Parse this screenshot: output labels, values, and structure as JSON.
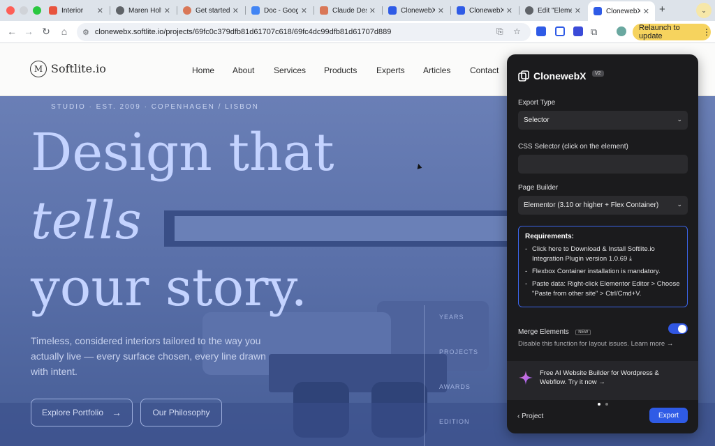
{
  "browser": {
    "tabs": [
      {
        "title": "Interior",
        "color": "#e8543e"
      },
      {
        "title": "Maren Holt",
        "color": "#5f6368"
      },
      {
        "title": "Get started",
        "color": "#d97757"
      },
      {
        "title": "Doc - Goog",
        "color": "#4285f4"
      },
      {
        "title": "Claude Des",
        "color": "#d97757"
      },
      {
        "title": "ClonewebX",
        "color": "#2f5be6"
      },
      {
        "title": "ClonewebX",
        "color": "#2f5be6"
      },
      {
        "title": "Edit \"Eleme",
        "color": "#5f6368"
      },
      {
        "title": "ClonewebX",
        "color": "#2f5be6"
      }
    ],
    "new_tab": "+",
    "url": "clonewebx.softlite.io/projects/69fc0c379dfb81d61707c618/69fc4dc99dfb81d61707d889",
    "relaunch_label": "Relaunch to update"
  },
  "site": {
    "logo_mark": "M",
    "logo_text": "Softlite.io",
    "nav": [
      "Home",
      "About",
      "Services",
      "Products",
      "Experts",
      "Articles",
      "Contact"
    ],
    "hero": {
      "eyebrow": "STUDIO · EST. 2009 · COPENHAGEN / LISBON",
      "line1": "Design that",
      "line2": "tells",
      "line3": "your story.",
      "subtitle": "Timeless, considered interiors tailored to the way you actually live — every surface chosen, every line drawn with intent.",
      "primary_button": "Explore Portfolio",
      "secondary_button": "Our Philosophy",
      "side_labels": [
        "YEARS",
        "PROJECTS",
        "AWARDS",
        "EDITION"
      ]
    }
  },
  "panel": {
    "title": "ClonewebX",
    "version": "V2",
    "export_type_label": "Export Type",
    "export_type_value": "Selector",
    "css_selector_label": "CSS Selector (click on the element)",
    "css_selector_value": "",
    "page_builder_label": "Page Builder",
    "page_builder_value": "Elementor (3.10 or higher + Flex Container)",
    "requirements": {
      "title": "Requirements:",
      "items": [
        "Click here to Download & Install Softlite.io Integration Plugin version 1.0.69",
        "Flexbox Container installation is mandatory.",
        "Paste data: Right-click Elementor Editor > Choose \"Paste from other site\" > Ctrl/Cmd+V."
      ]
    },
    "merge_label": "Merge Elements",
    "merge_badge": "NEW",
    "merge_enabled": true,
    "merge_help": "Disable this function for layout issues. Learn more",
    "promo_text": "Free AI Website Builder for Wordpress & Webflow. Try it now",
    "carousel_active_index": 0,
    "carousel_count": 2,
    "back_label": "Project",
    "export_label": "Export"
  }
}
